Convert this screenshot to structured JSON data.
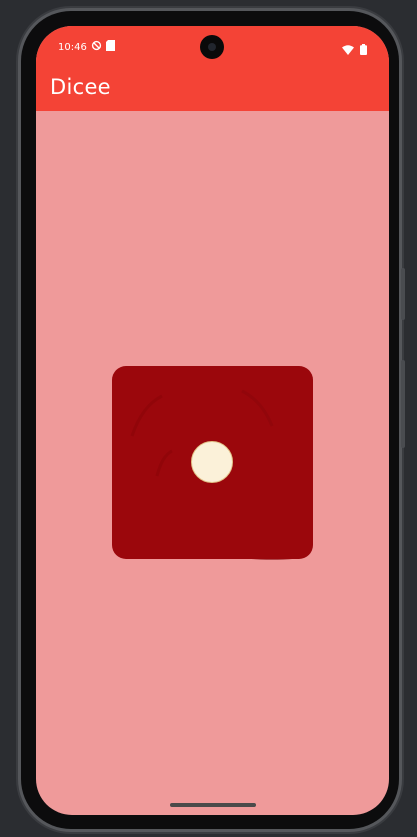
{
  "status_bar": {
    "time": "10:46",
    "left_icons": [
      "do-not-disturb-icon",
      "sim-card-icon"
    ],
    "right_icons": [
      "wifi-icon",
      "battery-icon"
    ],
    "background_color": "#f44336"
  },
  "app_bar": {
    "title": "Dicee",
    "background_color": "#f44336"
  },
  "body": {
    "background_color": "#ef9a9a"
  },
  "dice": {
    "face_value": 1,
    "face_color": "#9b070c",
    "pip_color": "#fbf1d9"
  }
}
